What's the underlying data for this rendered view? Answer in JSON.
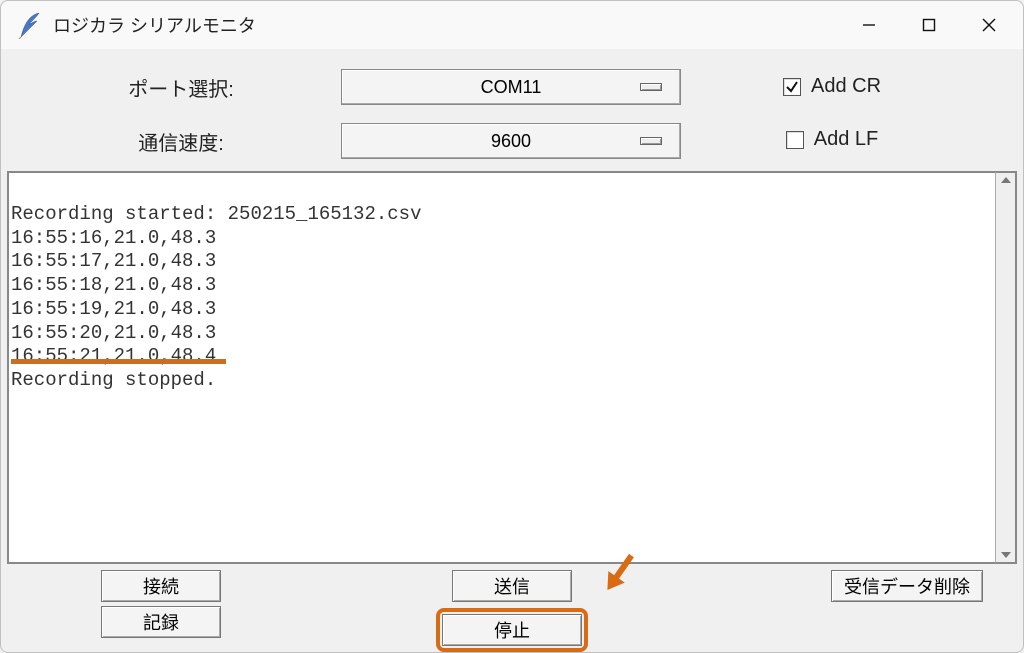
{
  "window": {
    "title": "ロジカラ シリアルモニタ"
  },
  "config": {
    "port_label": "ポート選択:",
    "port_value": "COM11",
    "baud_label": "通信速度:",
    "baud_value": "9600",
    "add_cr_label": "Add CR",
    "add_cr_checked": true,
    "add_lf_label": "Add LF",
    "add_lf_checked": false
  },
  "output_lines": [
    "",
    "Recording started: 250215_165132.csv",
    "16:55:16,21.0,48.3",
    "16:55:17,21.0,48.3",
    "16:55:18,21.0,48.3",
    "16:55:19,21.0,48.3",
    "16:55:20,21.0,48.3",
    "16:55:21,21.0,48.4",
    "Recording stopped."
  ],
  "buttons": {
    "connect": "接続",
    "record": "記録",
    "send": "送信",
    "stop": "停止",
    "clear_rx": "受信データ削除"
  },
  "annotation": {
    "highlight_color": "#d96b12"
  }
}
